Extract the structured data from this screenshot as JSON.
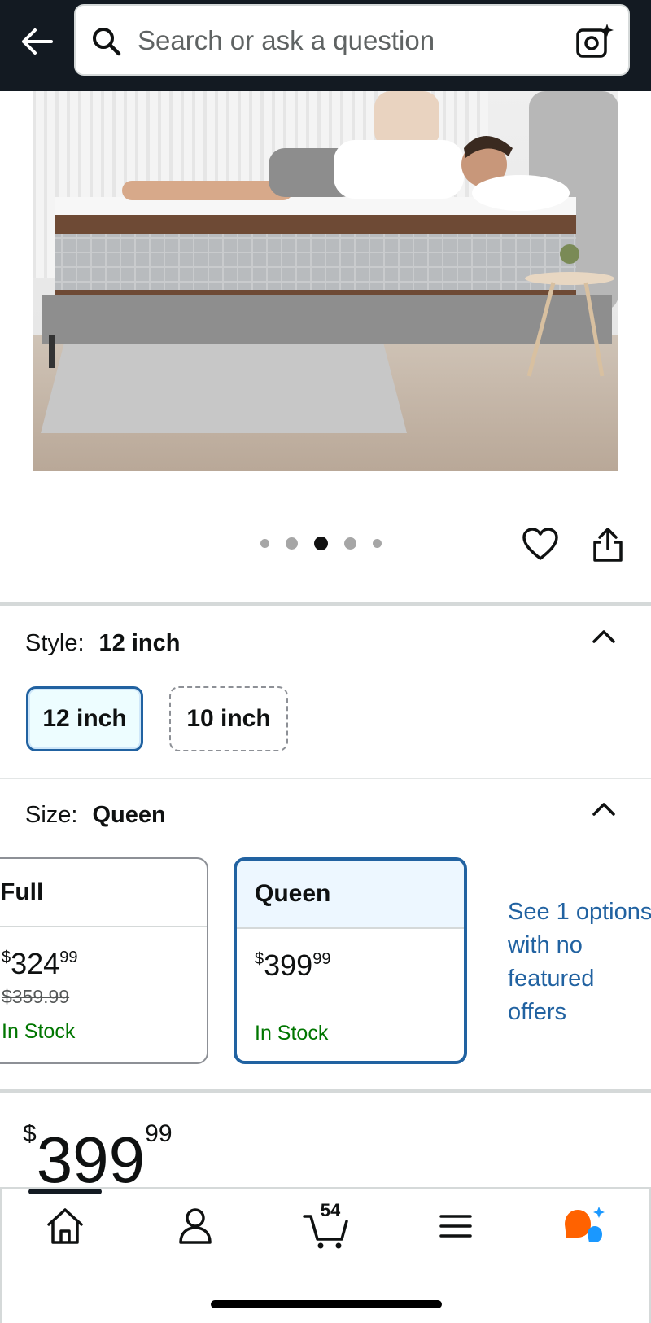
{
  "header": {
    "search_placeholder": "Search or ask a question",
    "icons": [
      "back-arrow-icon",
      "search-icon",
      "camera-sparkle-icon"
    ]
  },
  "carousel": {
    "dot_count": 5,
    "active_index": 2
  },
  "style": {
    "label": "Style:",
    "selected": "12 inch",
    "options": [
      {
        "label": "12 inch",
        "state": "selected"
      },
      {
        "label": "10 inch",
        "state": "unavailable"
      }
    ]
  },
  "size": {
    "label": "Size:",
    "selected": "Queen",
    "options": [
      {
        "name": "Full",
        "currency": "$",
        "price_whole": "324",
        "price_fraction": "99",
        "was_price": "$359.99",
        "availability": "In Stock"
      },
      {
        "name": "Queen",
        "currency": "$",
        "price_whole": "399",
        "price_fraction": "99",
        "availability": "In Stock"
      }
    ],
    "see_more": "See 1 options with no featured offers"
  },
  "price": {
    "currency": "$",
    "whole": "399",
    "fraction": "99"
  },
  "bottom_nav": {
    "items": [
      "home-icon",
      "account-icon",
      "cart-icon",
      "menu-icon",
      "rufus-assistant-icon"
    ],
    "cart_count": "54"
  },
  "colors": {
    "header_bg": "#131a22",
    "link_blue": "#2162a1",
    "selected_border": "#2162a1",
    "in_stock_green": "#007600",
    "assistant_orange": "#ff6200",
    "assistant_blue": "#1a98ff"
  }
}
